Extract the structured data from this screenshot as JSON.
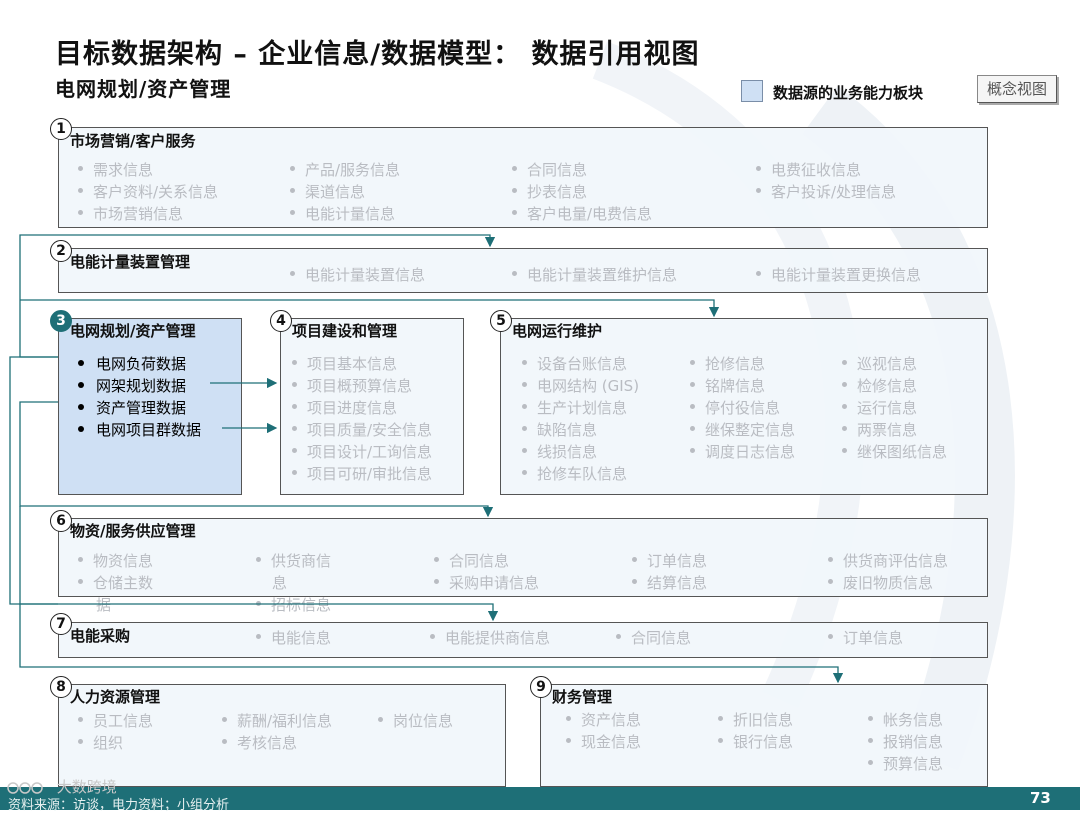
{
  "header": {
    "title": "目标数据架构 – 企业信息/数据模型： 数据引用视图",
    "subtitle": "电网规划/资产管理",
    "legend_label": "数据源的业务能力板块",
    "concept_badge": "概念视图"
  },
  "colors": {
    "accent": "#1e6f77",
    "highlight_box": "#cfe0f4",
    "inactive_text": "#b9bcc2"
  },
  "sections": [
    {
      "num": "1",
      "title": "市场营销/客户服务",
      "items": [
        "需求信息",
        "产品/服务信息",
        "合同信息",
        "电费征收信息",
        "客户资料/关系信息",
        "渠道信息",
        "抄表信息",
        "客户投诉/处理信息",
        "市场营销信息",
        "电能计量信息",
        "客户电量/电费信息"
      ]
    },
    {
      "num": "2",
      "title": "电能计量装置管理",
      "items": [
        "电能计量装置信息",
        "电能计量装置维护信息",
        "电能计量装置更换信息"
      ]
    },
    {
      "num": "3",
      "title": "电网规划/资产管理",
      "items": [
        "电网负荷数据",
        "网架规划数据",
        "资产管理数据",
        "电网项目群数据"
      ]
    },
    {
      "num": "4",
      "title": "项目建设和管理",
      "items": [
        "项目基本信息",
        "项目概预算信息",
        "项目进度信息",
        "项目质量/安全信息",
        "项目设计/工询信息",
        "项目可研/审批信息"
      ]
    },
    {
      "num": "5",
      "title": "电网运行维护",
      "items": [
        "设备台账信息",
        "抢修信息",
        "巡视信息",
        "电网结构 (GIS)",
        "铭牌信息",
        "检修信息",
        "生产计划信息",
        "停付役信息",
        "运行信息",
        "缺陷信息",
        "继保整定信息",
        "两票信息",
        "线损信息",
        "调度日志信息",
        "继保图纸信息",
        "抢修车队信息"
      ]
    },
    {
      "num": "6",
      "title": "物资/服务供应管理",
      "items": [
        "物资信息",
        "供货商信",
        "息",
        "合同信息",
        "订单信息",
        "供货商评估信息",
        "仓储主数",
        "据",
        "采购申请信息",
        "结算信息",
        "废旧物质信息",
        "招标信息"
      ]
    },
    {
      "num": "7",
      "title": "电能采购",
      "items": [
        "电能信息",
        "电能提供商信息",
        "合同信息",
        "订单信息"
      ]
    },
    {
      "num": "8",
      "title": "人力资源管理",
      "items": [
        "员工信息",
        "薪酬/福利信息",
        "岗位信息",
        "组织",
        "考核信息"
      ]
    },
    {
      "num": "9",
      "title": "财务管理",
      "items": [
        "资产信息",
        "折旧信息",
        "帐务信息",
        "现金信息",
        "银行信息",
        "报销信息",
        "预算信息"
      ]
    }
  ],
  "footer": {
    "source": "资料来源：访谈，电力资料；小组分析",
    "page": "73",
    "watermark": "大数跨境"
  }
}
